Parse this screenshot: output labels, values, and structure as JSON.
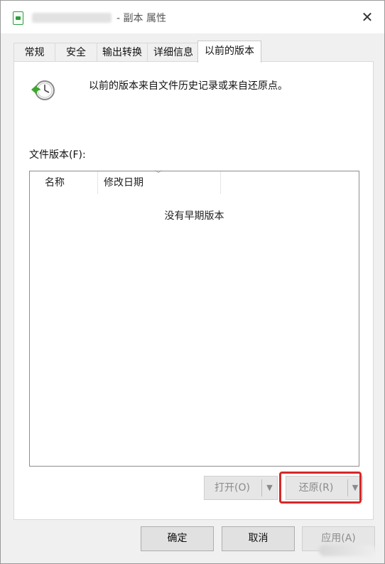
{
  "window": {
    "title_name_hidden": "",
    "title_suffix": "- 副本 属性",
    "close_glyph": "✕"
  },
  "tabs": [
    {
      "label": "常规",
      "active": false
    },
    {
      "label": "安全",
      "active": false
    },
    {
      "label": "输出转换",
      "active": false
    },
    {
      "label": "详细信息",
      "active": false
    },
    {
      "label": "以前的版本",
      "active": true
    }
  ],
  "panel": {
    "icon": "restore-history-clock-icon",
    "description": "以前的版本来自文件历史记录或来自还原点。",
    "versions_label": "文件版本(F):",
    "columns": [
      "名称",
      "修改日期"
    ],
    "empty_message": "没有早期版本"
  },
  "actions": {
    "open_label": "打开(O)",
    "restore_label": "还原(R)",
    "dropdown_glyph": "▼"
  },
  "dialog_buttons": {
    "ok": "确定",
    "cancel": "取消",
    "apply": "应用(A)"
  },
  "colors": {
    "highlight": "#d62828",
    "window_bg": "#f0f0f0"
  }
}
